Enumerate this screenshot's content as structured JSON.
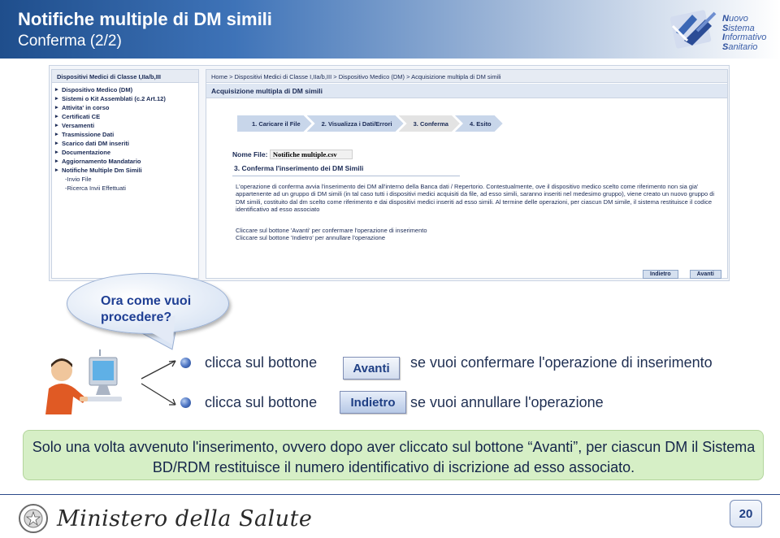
{
  "header": {
    "title": "Notifiche multiple di DM simili",
    "subtitle": "Conferma (2/2)",
    "logo": {
      "icon": "nsis-logo-icon",
      "lines": [
        "uovo",
        "istema",
        "nformativo",
        "anitario"
      ],
      "initials": [
        "N",
        "S",
        "I",
        "S"
      ]
    }
  },
  "screenshot": {
    "sidebar": {
      "title": "Dispositivi Medici di Classe I,IIa/b,III",
      "items": [
        {
          "label": "Dispositivo Medico (DM)",
          "type": "arrow"
        },
        {
          "label": "Sistemi o Kit Assemblati (c.2 Art.12)",
          "type": "arrow"
        },
        {
          "label": "Attivita' in corso",
          "type": "arrow"
        },
        {
          "label": "Certificati CE",
          "type": "arrow"
        },
        {
          "label": "Versamenti",
          "type": "arrow"
        },
        {
          "label": "Trasmissione Dati",
          "type": "arrow"
        },
        {
          "label": "Scarico dati DM inseriti",
          "type": "arrow"
        },
        {
          "label": "Documentazione",
          "type": "arrow"
        },
        {
          "label": "Aggiornamento Mandatario",
          "type": "arrow"
        },
        {
          "label": "Notifiche Multiple Dm Simili",
          "type": "arrow"
        },
        {
          "label": "-Invio File",
          "type": "sub"
        },
        {
          "label": "-Ricerca Invii Effettuati",
          "type": "sub"
        }
      ]
    },
    "breadcrumb": "Home > Dispositivi Medici di Classe I,IIa/b,III > Dispositivo Medico (DM) > Acquisizione multipla di DM simili",
    "page_title": "Acquisizione multipla di DM simili",
    "steps": [
      "1. Caricare il File",
      "2. Visualizza i Dati/Errori",
      "3. Conferma",
      "4. Esito"
    ],
    "active_step": 2,
    "file_label": "Nome File:",
    "file_name": "Notifiche multiple.csv",
    "section_title": "3. Conferma l'inserimento dei DM Simili",
    "description": "L'operazione di conferma avvia l'inserimento dei DM all'interno della Banca dati / Repertorio. Contestualmente, ove il dispositivo medico scelto come riferimento non sia gia' appartenente ad un gruppo di DM simili (in tal caso tutti i dispositivi medici acquisiti da file, ad esso simili, saranno inseriti nel medesimo gruppo), viene creato un nuovo gruppo di DM simili, costituito dal dm scelto come riferimento e dai dispositivi medici inseriti ad esso simili. Al termine delle operazioni, per ciascun DM simile, il sistema restituisce il codice identificativo ad esso associato",
    "instructions": [
      "Cliccare sul bottone 'Avanti' per confermare l'operazione di inserimento",
      "Cliccare sul bottone 'Indietro' per annullare l'operazione"
    ],
    "buttons": {
      "back": "Indietro",
      "next": "Avanti"
    }
  },
  "bubble": {
    "text": "Ora come vuoi procedere?"
  },
  "choices": [
    {
      "prefix": "clicca sul bottone",
      "button": "Avanti",
      "suffix": "se vuoi confermare l'operazione di inserimento"
    },
    {
      "prefix": "clicca sul bottone",
      "button": "Indietro",
      "suffix": "se vuoi annullare l'operazione"
    }
  ],
  "note": "Solo una volta avvenuto l'inserimento, ovvero dopo aver cliccato sul bottone “Avanti”, per ciascun DM il Sistema BD/RDM restituisce il numero identificativo di iscrizione ad esso associato.",
  "footer": {
    "ministry": "Ministero della Salute",
    "emblem": "italian-republic-emblem-icon",
    "page_number": "20"
  }
}
